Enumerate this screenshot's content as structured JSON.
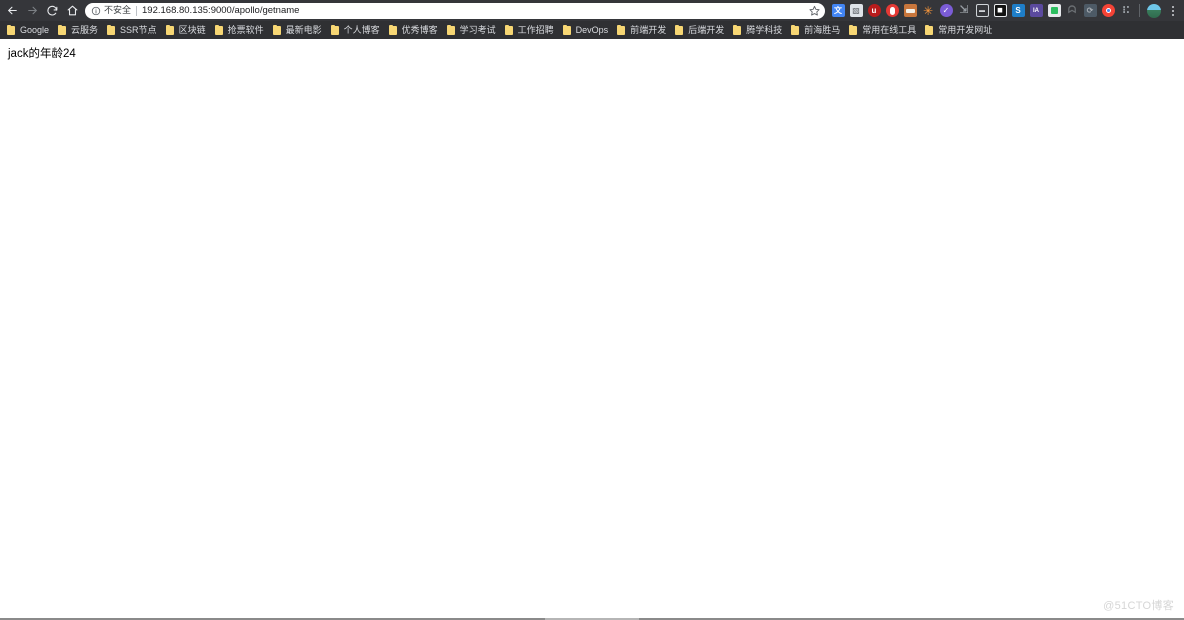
{
  "browser": {
    "nav": {
      "back_label": "Back",
      "forward_label": "Forward",
      "reload_label": "Reload",
      "home_label": "Home"
    },
    "omnibox": {
      "security_icon": "info-circle-icon",
      "security_text": "不安全",
      "url": "192.168.80.135:9000/apollo/getname",
      "bookmark_star_label": "Bookmark this tab"
    },
    "extensions": [
      {
        "name": "google-translate-extension",
        "glyph": "文",
        "bg": "#4285f4",
        "fg": "#ffffff"
      },
      {
        "name": "screenshot-extension",
        "glyph": "▧",
        "bg": "#e8eaed",
        "fg": "#5f6368"
      },
      {
        "name": "ublock-origin-extension",
        "glyph": "u",
        "bg": "#b91c1c",
        "fg": "#ffffff"
      },
      {
        "name": "red-shield-extension",
        "glyph": "●",
        "bg": "#e53935",
        "fg": "#ffffff"
      },
      {
        "name": "wappalyzer-extension",
        "glyph": "▣",
        "bg": "#c8763c",
        "fg": "#ffffff"
      },
      {
        "name": "postman-extension",
        "glyph": "✳",
        "bg": "#35363a",
        "fg": "#ff8a3c"
      },
      {
        "name": "grammar-check-extension",
        "glyph": "✓",
        "bg": "#7b5cd6",
        "fg": "#ffffff"
      },
      {
        "name": "mouse-gestures-extension",
        "glyph": "↘",
        "bg": "#35363a",
        "fg": "#9aa0a6"
      },
      {
        "name": "video-download-extension",
        "glyph": "▭",
        "bg": "#35363a",
        "fg": "#cfd3d7"
      },
      {
        "name": "dark-square-extension",
        "glyph": "◼",
        "bg": "#1a1a1a",
        "fg": "#ffffff"
      },
      {
        "name": "scribd-extension",
        "glyph": "S",
        "bg": "#1e7ec8",
        "fg": "#ffffff"
      },
      {
        "name": "ia-writer-extension",
        "glyph": "IA",
        "bg": "#5b4a9e",
        "fg": "#ffffff"
      },
      {
        "name": "evernote-extension",
        "glyph": "E",
        "bg": "#2dbe60",
        "fg": "#ffffff"
      },
      {
        "name": "ghost-extension",
        "glyph": "ᗣ",
        "bg": "#35363a",
        "fg": "#6b6f73"
      },
      {
        "name": "sync-extension",
        "glyph": "⟳",
        "bg": "#4a5a6a",
        "fg": "#9aa0a6"
      },
      {
        "name": "chrome-logo-extension",
        "glyph": "◉",
        "bg": "#f44336",
        "fg": "#ffffff"
      },
      {
        "name": "puzzle-extensions-button",
        "glyph": "⬚",
        "bg": "#35363a",
        "fg": "#9aa0a6"
      }
    ],
    "profile": {
      "name": "profile-avatar"
    },
    "menu": {
      "name": "chrome-menu-button"
    }
  },
  "bookmarks": [
    {
      "label": "Google",
      "latin": true
    },
    {
      "label": "云服务",
      "latin": false
    },
    {
      "label": "SSR节点",
      "latin": false
    },
    {
      "label": "区块链",
      "latin": false
    },
    {
      "label": "抢票软件",
      "latin": false
    },
    {
      "label": "最新电影",
      "latin": false
    },
    {
      "label": "个人博客",
      "latin": false
    },
    {
      "label": "优秀博客",
      "latin": false
    },
    {
      "label": "学习考试",
      "latin": false
    },
    {
      "label": "工作招聘",
      "latin": false
    },
    {
      "label": "DevOps",
      "latin": true
    },
    {
      "label": "前端开发",
      "latin": false
    },
    {
      "label": "后端开发",
      "latin": false
    },
    {
      "label": "腾学科技",
      "latin": false
    },
    {
      "label": "前海胜马",
      "latin": false
    },
    {
      "label": "常用在线工具",
      "latin": false
    },
    {
      "label": "常用开发网址",
      "latin": false
    }
  ],
  "page": {
    "body_text": "jack的年龄24",
    "watermark": "@51CTO博客"
  }
}
